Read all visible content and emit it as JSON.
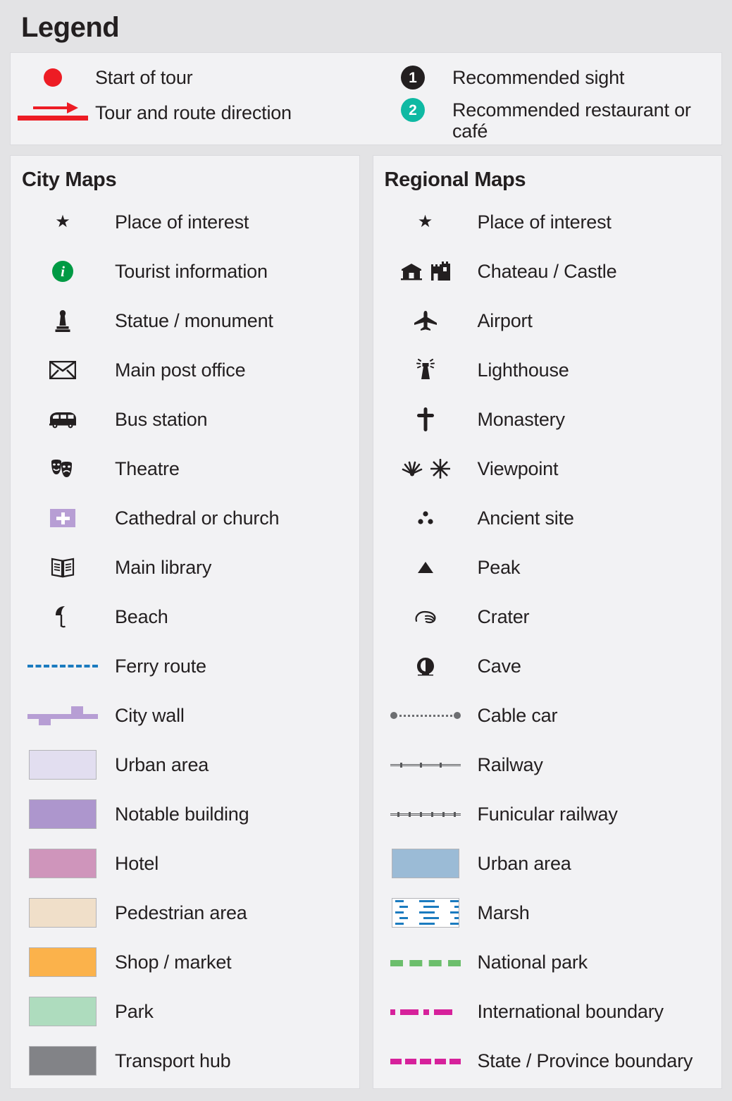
{
  "title": "Legend",
  "tour": {
    "items": [
      {
        "symbol": "red-dot",
        "label": "Start of tour"
      },
      {
        "symbol": "arrow-line",
        "label": "Tour and route direction"
      },
      {
        "symbol": "badge-1",
        "badge_text": "1",
        "label": "Recommended sight"
      },
      {
        "symbol": "badge-2",
        "badge_text": "2",
        "label": "Recommended restaurant or café"
      }
    ]
  },
  "city_maps": {
    "title": "City Maps",
    "items": [
      {
        "symbol": "star",
        "label": "Place of interest"
      },
      {
        "symbol": "info-circle",
        "label": "Tourist information"
      },
      {
        "symbol": "statue",
        "label": "Statue / monument"
      },
      {
        "symbol": "envelope",
        "label": "Main post office"
      },
      {
        "symbol": "bus",
        "label": "Bus station"
      },
      {
        "symbol": "theatre-masks",
        "label": "Theatre"
      },
      {
        "symbol": "church-cross",
        "label": "Cathedral or church"
      },
      {
        "symbol": "open-book",
        "label": "Main library"
      },
      {
        "symbol": "beach-umbrella",
        "label": "Beach"
      },
      {
        "symbol": "dashed-line-blue",
        "label": "Ferry route"
      },
      {
        "symbol": "city-wall-line",
        "label": "City wall"
      },
      {
        "symbol": "swatch",
        "label": "Urban area",
        "color": "#e2def0"
      },
      {
        "symbol": "swatch",
        "label": "Notable building",
        "color": "#ad96cd"
      },
      {
        "symbol": "swatch",
        "label": "Hotel",
        "color": "#cf95bb"
      },
      {
        "symbol": "swatch",
        "label": "Pedestrian area",
        "color": "#f0dfc9"
      },
      {
        "symbol": "swatch",
        "label": "Shop / market",
        "color": "#fbb24b"
      },
      {
        "symbol": "swatch",
        "label": "Park",
        "color": "#aedcbe"
      },
      {
        "symbol": "swatch",
        "label": "Transport hub",
        "color": "#828387"
      }
    ]
  },
  "regional_maps": {
    "title": "Regional Maps",
    "items": [
      {
        "symbol": "star",
        "label": "Place of interest"
      },
      {
        "symbol": "chateau-castle",
        "label": "Chateau / Castle"
      },
      {
        "symbol": "airplane",
        "label": "Airport"
      },
      {
        "symbol": "lighthouse",
        "label": "Lighthouse"
      },
      {
        "symbol": "cross",
        "label": "Monastery"
      },
      {
        "symbol": "viewpoint-burst",
        "label": "Viewpoint"
      },
      {
        "symbol": "three-dots",
        "label": "Ancient site"
      },
      {
        "symbol": "triangle",
        "label": "Peak"
      },
      {
        "symbol": "crater",
        "label": "Crater"
      },
      {
        "symbol": "cave",
        "label": "Cave"
      },
      {
        "symbol": "dotted-line-cable",
        "label": "Cable car"
      },
      {
        "symbol": "railway-line",
        "label": "Railway"
      },
      {
        "symbol": "funicular-line",
        "label": "Funicular railway"
      },
      {
        "symbol": "swatch",
        "label": "Urban area",
        "color": "#9bbbd6"
      },
      {
        "symbol": "marsh-pattern",
        "label": "Marsh"
      },
      {
        "symbol": "dashed-line-green",
        "label": "National park"
      },
      {
        "symbol": "dash-dot-line-magenta",
        "label": "International boundary"
      },
      {
        "symbol": "dashed-line-magenta",
        "label": "State / Province boundary"
      }
    ]
  },
  "colors": {
    "page_background": "#e3e3e5",
    "panel_background": "#f2f2f4",
    "tour_red": "#ed1c24",
    "badge_dark": "#231f20",
    "badge_teal": "#0fb9a3",
    "info_green": "#009a44",
    "purple": "#b79ed4",
    "ferry_blue": "#1b7bbf",
    "cable_grey": "#6d6e71",
    "park_green": "#6cbe6c",
    "boundary_magenta": "#d6219b"
  }
}
